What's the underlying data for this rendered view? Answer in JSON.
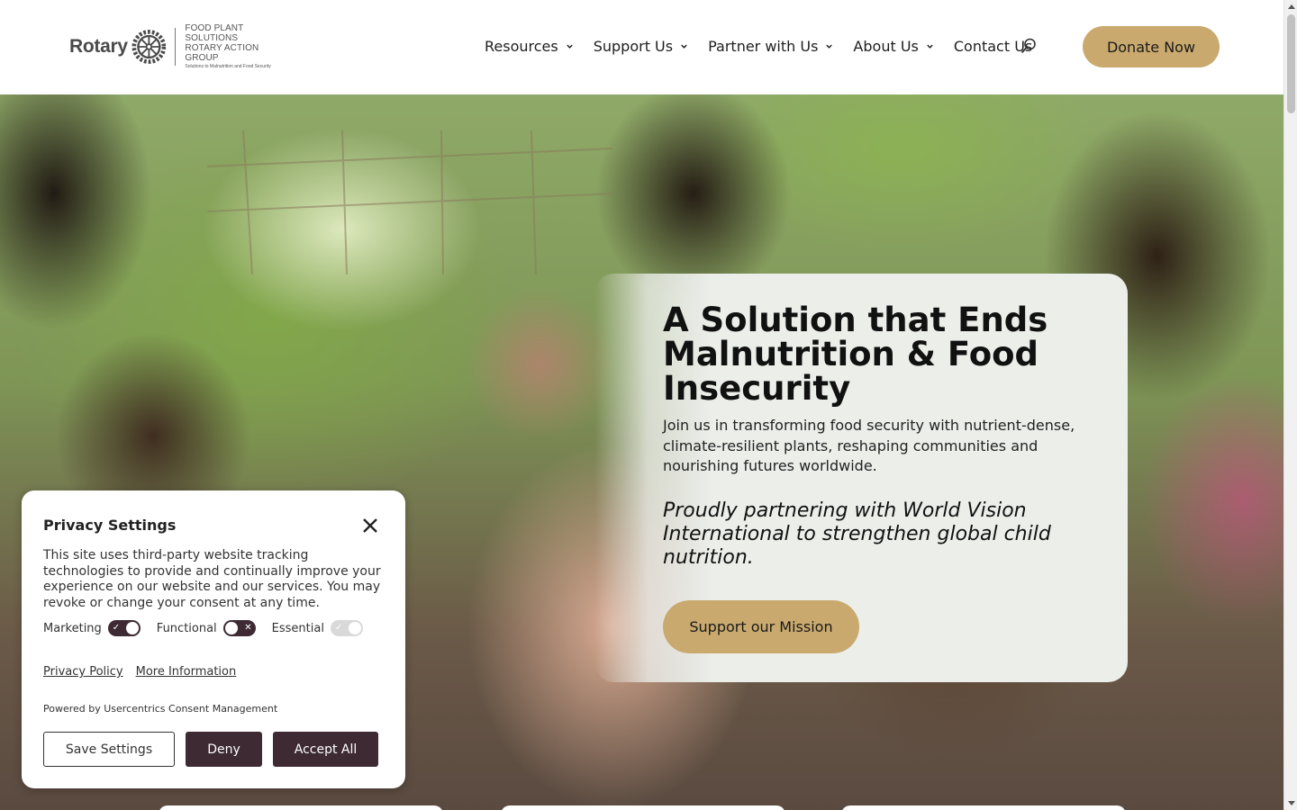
{
  "header": {
    "logo": {
      "wordmark": "Rotary",
      "line1": "FOOD PLANT SOLUTIONS",
      "line2": "ROTARY ACTION GROUP",
      "line3": "Solutions to Malnutrition and Food Security"
    },
    "nav": [
      {
        "label": "Resources",
        "has_dropdown": true
      },
      {
        "label": "Support Us",
        "has_dropdown": true
      },
      {
        "label": "Partner with Us",
        "has_dropdown": true
      },
      {
        "label": "About Us",
        "has_dropdown": true
      },
      {
        "label": "Contact Us",
        "has_dropdown": false
      }
    ],
    "search_icon": "search-icon",
    "donate_label": "Donate Now"
  },
  "hero": {
    "title": "A Solution that Ends Malnutrition & Food Insecurity",
    "subtitle": "Join us in transforming food security with nutrient-dense, climate-resilient plants, reshaping communities and nourishing futures worldwide.",
    "partner_text": "Proudly partnering with World Vision International to strengthen global child nutrition.",
    "cta_label": "Support our Mission"
  },
  "privacy": {
    "title": "Privacy Settings",
    "description": "This site uses third-party website tracking technologies to provide and continually improve your experience on our website and our services. You may revoke or change your consent at any time.",
    "toggles": [
      {
        "label": "Marketing",
        "state": "on"
      },
      {
        "label": "Functional",
        "state": "off"
      },
      {
        "label": "Essential",
        "state": "on-disabled"
      }
    ],
    "links": [
      "Privacy Policy",
      "More Information"
    ],
    "powered_by": "Powered by Usercentrics Consent Management",
    "buttons": {
      "save": "Save Settings",
      "deny": "Deny",
      "accept": "Accept All"
    }
  },
  "colors": {
    "accent_gold": "#c9a96e",
    "consent_dark": "#3d2a33",
    "card_bg": "#eceeea"
  }
}
